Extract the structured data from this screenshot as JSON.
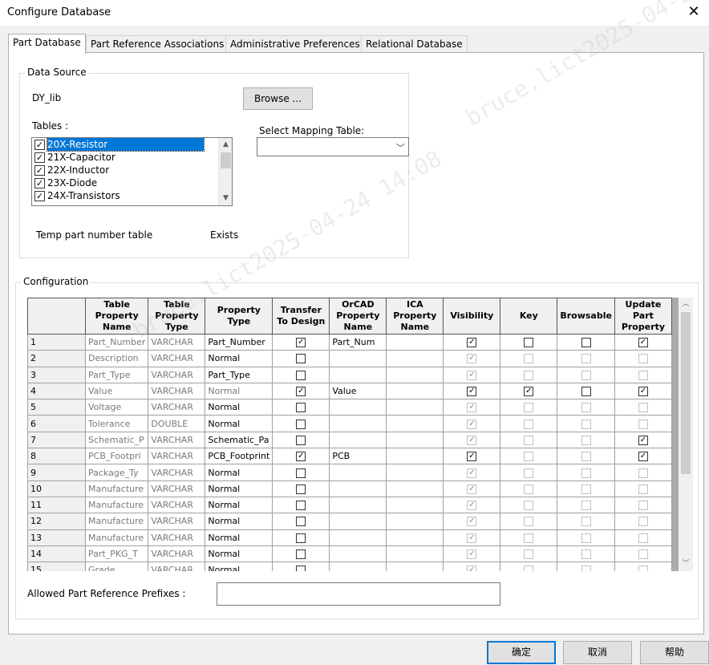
{
  "window": {
    "title": "Configure Database",
    "close_glyph": "✕"
  },
  "tabs": [
    {
      "label": "Part Database",
      "active": true
    },
    {
      "label": "Part Reference Associations",
      "active": false
    },
    {
      "label": "Administrative Preferences",
      "active": false
    },
    {
      "label": "Relational Database",
      "active": false
    }
  ],
  "data_source": {
    "group_label": "Data Source",
    "name": "DY_lib",
    "browse_label": "Browse ...",
    "tables_label": "Tables :",
    "tables": [
      {
        "label": "20X-Resistor",
        "checked": true,
        "selected": true
      },
      {
        "label": "21X-Capacitor",
        "checked": true,
        "selected": false
      },
      {
        "label": "22X-Inductor",
        "checked": true,
        "selected": false
      },
      {
        "label": "23X-Diode",
        "checked": true,
        "selected": false
      },
      {
        "label": "24X-Transistors",
        "checked": true,
        "selected": false
      }
    ],
    "mapping_label": "Select Mapping Table:",
    "mapping_value": "",
    "temp_label": "Temp part number table",
    "temp_status": "Exists"
  },
  "configuration": {
    "group_label": "Configuration",
    "headers": [
      "",
      "Table Property Name",
      "Table Property Type",
      "Property Type",
      "Transfer To Design",
      "OrCAD Property Name",
      "ICA Property Name",
      "Visibility",
      "Key",
      "Browsable",
      "Update Part Property"
    ],
    "rows": [
      {
        "n": "1",
        "name": "Part_Number",
        "type": "VARCHAR",
        "ptype": "Part_Number",
        "ptype_gray": false,
        "transfer": true,
        "orcad": "Part_Num",
        "ica": "",
        "vis": true,
        "vis_en": true,
        "key": false,
        "key_en": true,
        "browse": false,
        "browse_en": true,
        "update": true,
        "update_en": true
      },
      {
        "n": "2",
        "name": "Description",
        "type": "VARCHAR",
        "ptype": "Normal",
        "ptype_gray": false,
        "transfer": false,
        "orcad": "",
        "ica": "",
        "vis": true,
        "vis_en": false,
        "key": false,
        "key_en": false,
        "browse": false,
        "browse_en": false,
        "update": false,
        "update_en": false
      },
      {
        "n": "3",
        "name": "Part_Type",
        "type": "VARCHAR",
        "ptype": "Part_Type",
        "ptype_gray": false,
        "transfer": false,
        "orcad": "",
        "ica": "",
        "vis": true,
        "vis_en": false,
        "key": false,
        "key_en": false,
        "browse": false,
        "browse_en": false,
        "update": false,
        "update_en": false
      },
      {
        "n": "4",
        "name": "Value",
        "type": "VARCHAR",
        "ptype": "Normal",
        "ptype_gray": true,
        "transfer": true,
        "orcad": "Value",
        "ica": "",
        "vis": true,
        "vis_en": true,
        "key": true,
        "key_en": true,
        "browse": false,
        "browse_en": true,
        "update": true,
        "update_en": true
      },
      {
        "n": "5",
        "name": "Voltage",
        "type": "VARCHAR",
        "ptype": "Normal",
        "ptype_gray": false,
        "transfer": false,
        "orcad": "",
        "ica": "",
        "vis": true,
        "vis_en": false,
        "key": false,
        "key_en": false,
        "browse": false,
        "browse_en": false,
        "update": false,
        "update_en": false
      },
      {
        "n": "6",
        "name": "Tolerance",
        "type": "DOUBLE",
        "ptype": "Normal",
        "ptype_gray": false,
        "transfer": false,
        "orcad": "",
        "ica": "",
        "vis": true,
        "vis_en": false,
        "key": false,
        "key_en": false,
        "browse": false,
        "browse_en": false,
        "update": false,
        "update_en": false
      },
      {
        "n": "7",
        "name": "Schematic_P",
        "type": "VARCHAR",
        "ptype": "Schematic_Pa",
        "ptype_gray": false,
        "transfer": false,
        "orcad": "",
        "ica": "",
        "vis": true,
        "vis_en": false,
        "key": false,
        "key_en": false,
        "browse": false,
        "browse_en": false,
        "update": true,
        "update_en": true
      },
      {
        "n": "8",
        "name": "PCB_Footpri",
        "type": "VARCHAR",
        "ptype": "PCB_Footprint",
        "ptype_gray": false,
        "transfer": true,
        "orcad": "PCB",
        "ica": "",
        "vis": true,
        "vis_en": true,
        "key": false,
        "key_en": false,
        "browse": false,
        "browse_en": false,
        "update": true,
        "update_en": true
      },
      {
        "n": "9",
        "name": "Package_Ty",
        "type": "VARCHAR",
        "ptype": "Normal",
        "ptype_gray": false,
        "transfer": false,
        "orcad": "",
        "ica": "",
        "vis": true,
        "vis_en": false,
        "key": false,
        "key_en": false,
        "browse": false,
        "browse_en": false,
        "update": false,
        "update_en": false
      },
      {
        "n": "10",
        "name": "Manufacture",
        "type": "VARCHAR",
        "ptype": "Normal",
        "ptype_gray": false,
        "transfer": false,
        "orcad": "",
        "ica": "",
        "vis": true,
        "vis_en": false,
        "key": false,
        "key_en": false,
        "browse": false,
        "browse_en": false,
        "update": false,
        "update_en": false
      },
      {
        "n": "11",
        "name": "Manufacture",
        "type": "VARCHAR",
        "ptype": "Normal",
        "ptype_gray": false,
        "transfer": false,
        "orcad": "",
        "ica": "",
        "vis": true,
        "vis_en": false,
        "key": false,
        "key_en": false,
        "browse": false,
        "browse_en": false,
        "update": false,
        "update_en": false
      },
      {
        "n": "12",
        "name": "Manufacture",
        "type": "VARCHAR",
        "ptype": "Normal",
        "ptype_gray": false,
        "transfer": false,
        "orcad": "",
        "ica": "",
        "vis": true,
        "vis_en": false,
        "key": false,
        "key_en": false,
        "browse": false,
        "browse_en": false,
        "update": false,
        "update_en": false
      },
      {
        "n": "13",
        "name": "Manufacture",
        "type": "VARCHAR",
        "ptype": "Normal",
        "ptype_gray": false,
        "transfer": false,
        "orcad": "",
        "ica": "",
        "vis": true,
        "vis_en": false,
        "key": false,
        "key_en": false,
        "browse": false,
        "browse_en": false,
        "update": false,
        "update_en": false
      },
      {
        "n": "14",
        "name": "Part_PKG_T",
        "type": "VARCHAR",
        "ptype": "Normal",
        "ptype_gray": false,
        "transfer": false,
        "orcad": "",
        "ica": "",
        "vis": true,
        "vis_en": false,
        "key": false,
        "key_en": false,
        "browse": false,
        "browse_en": false,
        "update": false,
        "update_en": false
      },
      {
        "n": "15",
        "name": "Grade",
        "type": "VARCHAR",
        "ptype": "Normal",
        "ptype_gray": false,
        "transfer": false,
        "orcad": "",
        "ica": "",
        "vis": true,
        "vis_en": false,
        "key": false,
        "key_en": false,
        "browse": false,
        "browse_en": false,
        "update": false,
        "update_en": false
      }
    ]
  },
  "prefixes": {
    "label": "Allowed Part Reference Prefixes :",
    "value": ""
  },
  "buttons": {
    "ok": "确定",
    "cancel": "取消",
    "help": "帮助"
  },
  "watermark": [
    "bruce.lict2025-04-24 14:08"
  ]
}
